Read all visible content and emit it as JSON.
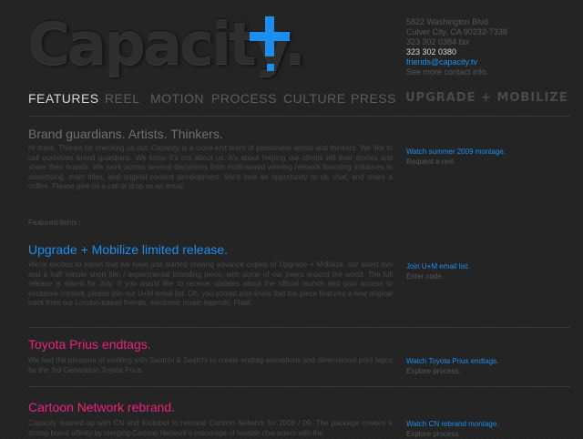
{
  "logo": {
    "text": "Capacity."
  },
  "contact": {
    "address1": "5822 Washington Blvd",
    "address2": "Culver City, CA 90232-7338",
    "fax": "323 302 0384 fax",
    "phone": "323 302 0380",
    "email": "friends@capacity.tv",
    "more": "See more contact info."
  },
  "nav": {
    "features": "FEATURES",
    "reel": "REEL",
    "motion": "MOTION",
    "process": "PROCESS",
    "culture": "CULTURE",
    "press": "PRESS",
    "upgrade": "UPGRADE + MOBILIZE"
  },
  "intro": {
    "title": "Brand guardians. Artists. Thinkers.",
    "body": "Hi there. Thanks for checking us out. Capacity is a close-knit team of passionate artists and thinkers. We like to call ourselves brand guardians. We know it's not about us. It's about helping our clients tell their stories and share their brands. We work across several disciplines from multi-award winning network branding initiatives to advertising, main titles, and original content development. We'd love an opportunity to sit, chat, and share a coffee. Please give us a call or drop us an email.",
    "link": "Watch summer 2009 montage.",
    "sub": "Request a reel."
  },
  "featured_label": "Featured items :",
  "items": [
    {
      "title": "Upgrade + Mobilize limited release.",
      "body": "We're excited to report that we have just started sharing advance copies of Upgrade + Mobilize, our latest two and a half minute short film / experimental branding piece, with some of our peers around the world. The full release is slated for July. If you would like to receive updates about the official launch and gain access to exclusive content, please join our U+M email list. Oh, you should also know that the piece features a new original track from our London-based friends, electronic music legends, Plaid.",
      "link": "Join U+M email list.",
      "sub": "Enter code."
    },
    {
      "title": "Toyota Prius endtags.",
      "body": "We had the pleasure of working with Saatchi & Saatchi to create endtag animations and dimensional print logos for the 3rd Generation Toyota Prius.",
      "link": "Watch Toyota Prius endtags.",
      "sub": "Explore process."
    },
    {
      "title": "Cartoon Network rebrand.",
      "body": "Capacity teamed up with CN and Kidrobot to rebrand Cartoon Network for 2008 / 09. The package creates a strong brand affinity by merging Cartoon Network's entourage of lovable characters with the",
      "link": "Watch CN rebrand montage.",
      "sub": "Explore process."
    }
  ],
  "colors": {
    "background": "#232323",
    "accent_blue": "#1b8ef0",
    "accent_pink": "#e8237a",
    "nav_active": "#d8d8d8",
    "nav_inactive": "#5d5d5d"
  }
}
